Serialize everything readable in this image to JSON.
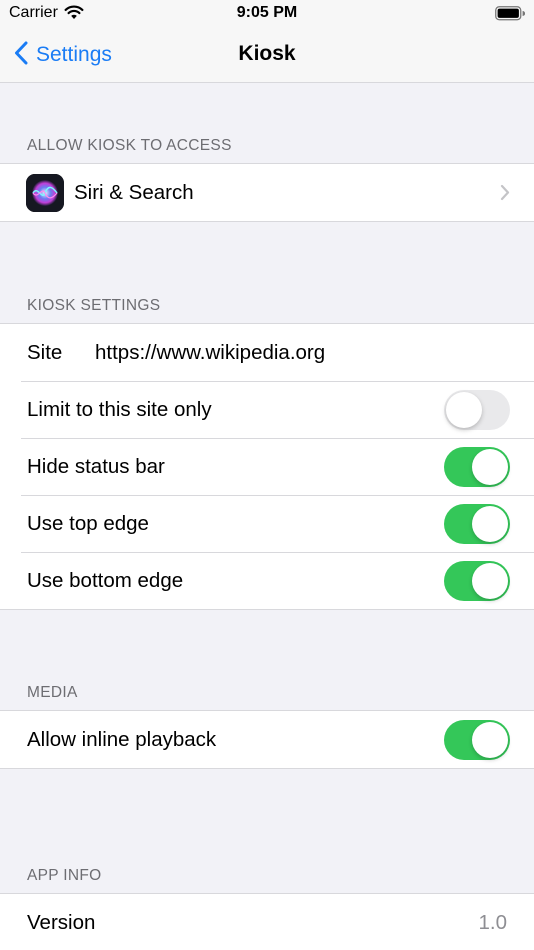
{
  "status_bar": {
    "carrier": "Carrier",
    "time": "9:05 PM"
  },
  "nav": {
    "back_label": "Settings",
    "title": "Kiosk"
  },
  "sections": {
    "access": {
      "header": "ALLOW KIOSK TO ACCESS",
      "siri_label": "Siri & Search"
    },
    "settings": {
      "header": "KIOSK SETTINGS",
      "site_label": "Site",
      "site_value": "https://www.wikipedia.org",
      "rows": [
        {
          "label": "Limit to this site only",
          "on": false
        },
        {
          "label": "Hide status bar",
          "on": true
        },
        {
          "label": "Use top edge",
          "on": true
        },
        {
          "label": "Use bottom edge",
          "on": true
        }
      ]
    },
    "media": {
      "header": "MEDIA",
      "rows": [
        {
          "label": "Allow inline playback",
          "on": true
        }
      ]
    },
    "app_info": {
      "header": "APP INFO",
      "version_label": "Version",
      "version_value": "1.0"
    }
  },
  "colors": {
    "accent": "#1a7cf5",
    "toggle_on": "#34c759",
    "toggle_off": "#e9e9eb",
    "background": "#f2f2f7"
  },
  "icons": [
    "wifi-icon",
    "battery-icon",
    "back-chevron-icon",
    "siri-icon",
    "chevron-right-icon"
  ]
}
